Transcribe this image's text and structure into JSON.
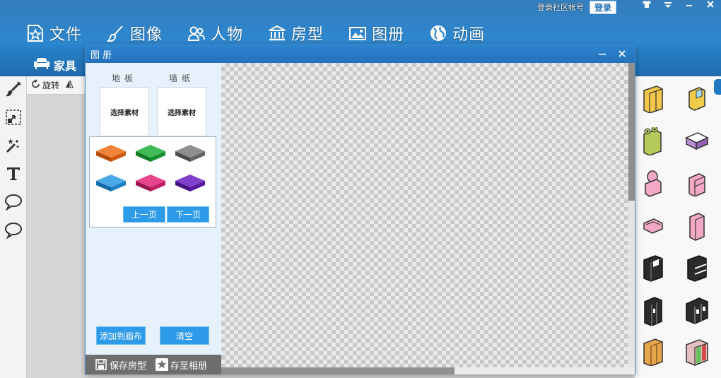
{
  "header": {
    "login_link": "登录社区帐号",
    "login_button": "登录",
    "window_controls": [
      "shirt-icon",
      "dropdown-icon",
      "minimize-icon",
      "close-icon"
    ],
    "menu": [
      {
        "label": "文件",
        "icon": "star-file-icon"
      },
      {
        "label": "图像",
        "icon": "brush-icon"
      },
      {
        "label": "人物",
        "icon": "people-icon"
      },
      {
        "label": "房型",
        "icon": "building-icon"
      },
      {
        "label": "图册",
        "icon": "album-icon"
      },
      {
        "label": "动画",
        "icon": "globe-icon"
      }
    ],
    "subtab": {
      "label": "家具",
      "icon": "sofa-icon"
    }
  },
  "toolbar": {
    "tools": [
      "brush-icon",
      "resize-icon",
      "magic-wand-icon",
      "text-icon",
      "speech-bubble-icon",
      "speech-bubble-icon"
    ],
    "rotate_label": "旋转"
  },
  "dialog": {
    "title": "图册",
    "floor_label": "地板",
    "wallpaper_label": "墙纸",
    "select_material": "选择素材",
    "swatches": [
      {
        "color": "#ee6a12"
      },
      {
        "color": "#1fb03a"
      },
      {
        "color": "#7c7c7c"
      },
      {
        "color": "#2b9be6"
      },
      {
        "color": "#e3247a"
      },
      {
        "color": "#6a1fc2"
      }
    ],
    "prev_page": "上一页",
    "next_page": "下一页",
    "add_to_canvas": "添加到画布",
    "clear": "清空",
    "save_room": "保存房型",
    "save_to_album": "存至相册"
  },
  "colors": {
    "accent": "#2d9be7",
    "header": "#2a86cf"
  }
}
